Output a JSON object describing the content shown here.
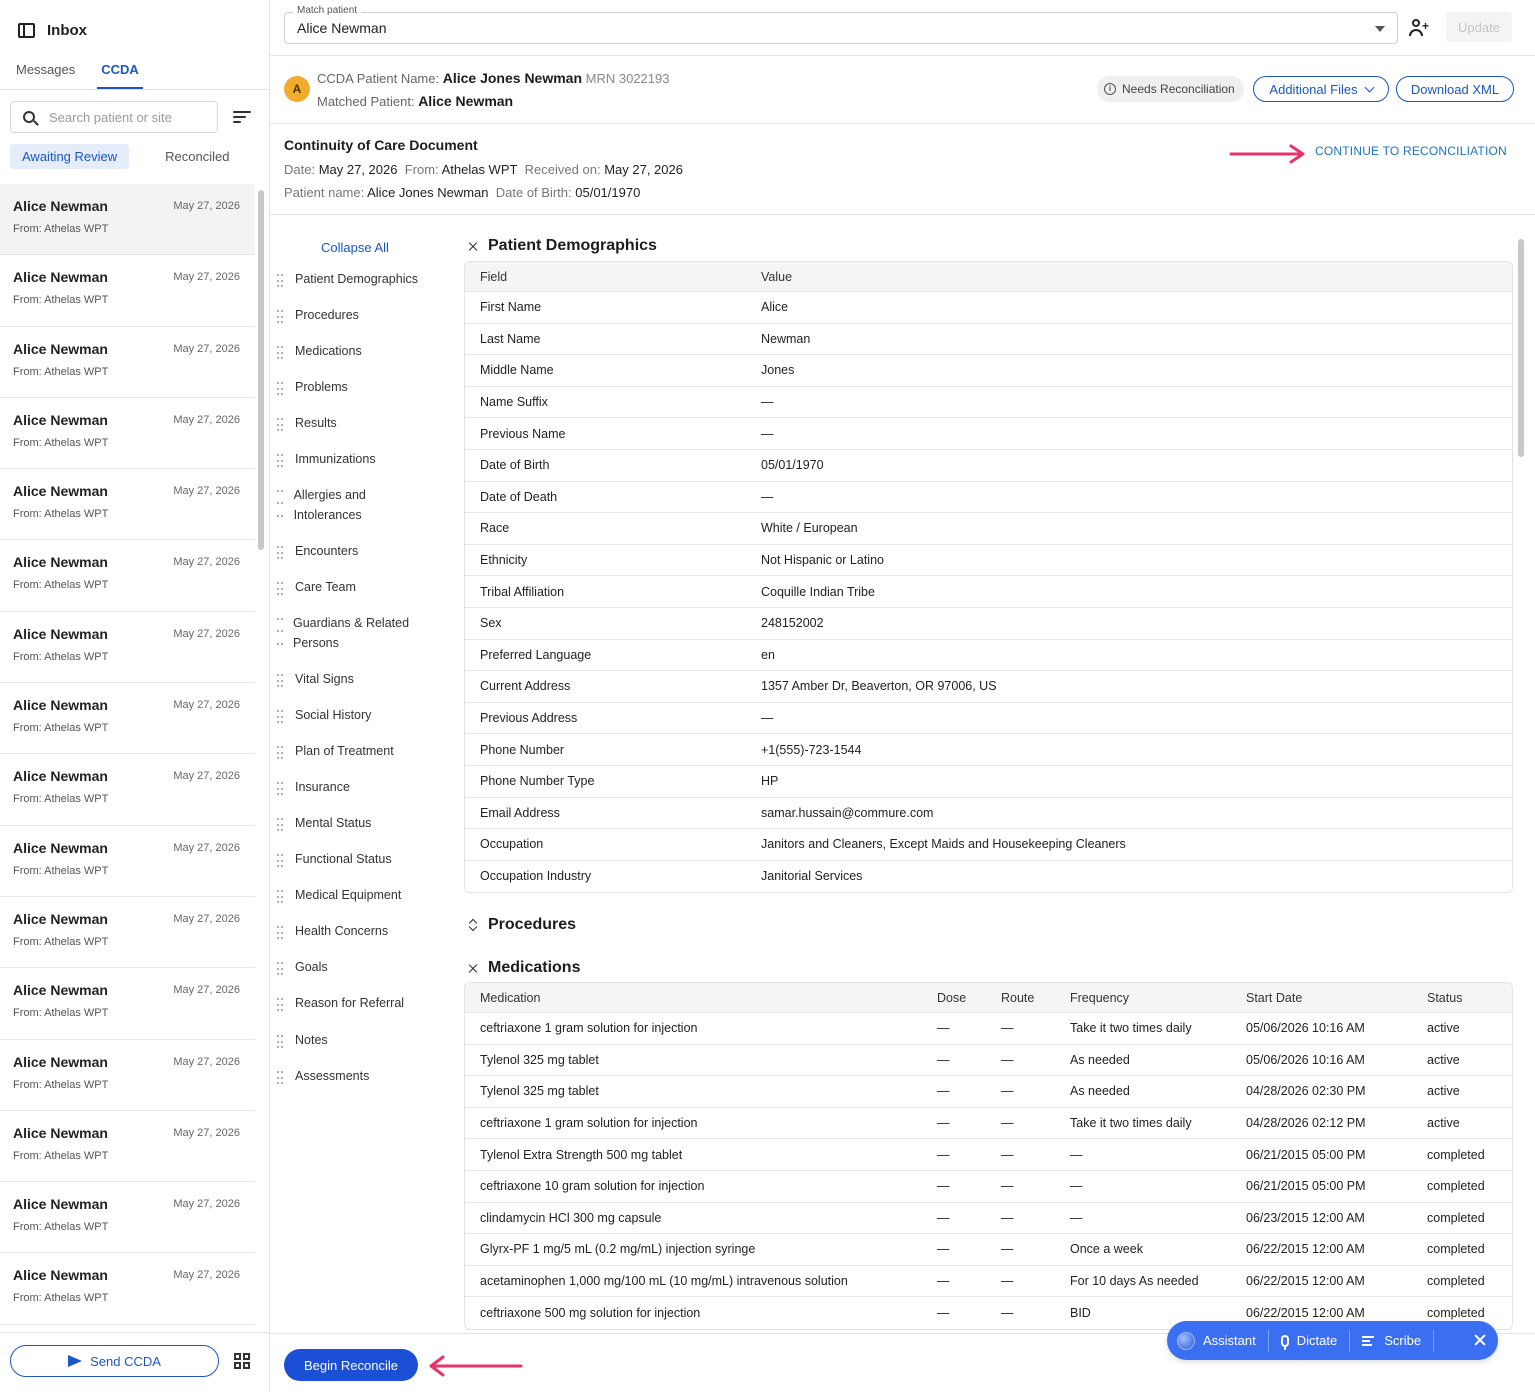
{
  "sidebar": {
    "title": "Inbox",
    "tabs": [
      "Messages",
      "CCDA"
    ],
    "active_tab": "CCDA",
    "search_placeholder": "Search patient or site",
    "filters": [
      "Awaiting Review",
      "Reconciled"
    ],
    "items": [
      {
        "name": "Alice Newman",
        "date": "May 27, 2026",
        "from": "From:  Athelas WPT"
      },
      {
        "name": "Alice Newman",
        "date": "May 27, 2026",
        "from": "From:  Athelas WPT"
      },
      {
        "name": "Alice Newman",
        "date": "May 27, 2026",
        "from": "From:  Athelas WPT"
      },
      {
        "name": "Alice Newman",
        "date": "May 27, 2026",
        "from": "From:  Athelas WPT"
      },
      {
        "name": "Alice Newman",
        "date": "May 27, 2026",
        "from": "From:  Athelas WPT"
      },
      {
        "name": "Alice Newman",
        "date": "May 27, 2026",
        "from": "From:  Athelas WPT"
      },
      {
        "name": "Alice Newman",
        "date": "May 27, 2026",
        "from": "From:  Athelas WPT"
      },
      {
        "name": "Alice Newman",
        "date": "May 27, 2026",
        "from": "From:  Athelas WPT"
      },
      {
        "name": "Alice Newman",
        "date": "May 27, 2026",
        "from": "From:  Athelas WPT"
      },
      {
        "name": "Alice Newman",
        "date": "May 27, 2026",
        "from": "From:  Athelas WPT"
      },
      {
        "name": "Alice Newman",
        "date": "May 27, 2026",
        "from": "From:  Athelas WPT"
      },
      {
        "name": "Alice Newman",
        "date": "May 27, 2026",
        "from": "From:  Athelas WPT"
      },
      {
        "name": "Alice Newman",
        "date": "May 27, 2026",
        "from": "From:  Athelas WPT"
      },
      {
        "name": "Alice Newman",
        "date": "May 27, 2026",
        "from": "From:  Athelas WPT"
      },
      {
        "name": "Alice Newman",
        "date": "May 27, 2026",
        "from": "From:  Athelas WPT"
      },
      {
        "name": "Alice Newman",
        "date": "May 27, 2026",
        "from": "From:  Athelas WPT"
      }
    ],
    "send_label": "Send CCDA"
  },
  "topbar": {
    "match_label": "Match patient",
    "match_value": "Alice Newman",
    "update_label": "Update"
  },
  "patient_bar": {
    "avatar_initial": "A",
    "ccda_name_label": "CCDA Patient Name:",
    "ccda_name": "Alice Jones Newman",
    "mrn": "MRN 3022193",
    "matched_label": "Matched Patient:",
    "matched_name": "Alice Newman",
    "badge": "Needs Reconciliation",
    "additional_files": "Additional Files",
    "download_xml": "Download XML"
  },
  "doc": {
    "title": "Continuity of Care Document",
    "date_label": "Date:",
    "date": "May 27, 2026",
    "from_label": "From:",
    "from": "Athelas WPT",
    "received_label": "Received on:",
    "received": "May 27, 2026",
    "patient_label": "Patient name:",
    "patient": "Alice Jones Newman",
    "dob_label": "Date of Birth:",
    "dob": "05/01/1970",
    "continue": "CONTINUE TO RECONCILIATION"
  },
  "toc": {
    "collapse_all": "Collapse All",
    "items": [
      "Patient Demographics",
      "Procedures",
      "Medications",
      "Problems",
      "Results",
      "Immunizations",
      "Allergies and Intolerances",
      "Encounters",
      "Care Team",
      "Guardians & Related Persons",
      "Vital Signs",
      "Social History",
      "Plan of Treatment",
      "Insurance",
      "Mental Status",
      "Functional Status",
      "Medical Equipment",
      "Health Concerns",
      "Goals",
      "Reason for Referral",
      "Notes",
      "Assessments"
    ]
  },
  "demographics": {
    "title": "Patient Demographics",
    "headers": [
      "Field",
      "Value"
    ],
    "rows": [
      [
        "First Name",
        "Alice"
      ],
      [
        "Last Name",
        "Newman"
      ],
      [
        "Middle Name",
        "Jones"
      ],
      [
        "Name Suffix",
        "—"
      ],
      [
        "Previous Name",
        "—"
      ],
      [
        "Date of Birth",
        "05/01/1970"
      ],
      [
        "Date of Death",
        "—"
      ],
      [
        "Race",
        "White / European"
      ],
      [
        "Ethnicity",
        "Not Hispanic or Latino"
      ],
      [
        "Tribal Affiliation",
        "Coquille Indian Tribe"
      ],
      [
        "Sex",
        "248152002"
      ],
      [
        "Preferred Language",
        "en"
      ],
      [
        "Current Address",
        "1357 Amber Dr, Beaverton, OR 97006, US"
      ],
      [
        "Previous Address",
        "—"
      ],
      [
        "Phone Number",
        "+1(555)-723-1544"
      ],
      [
        "Phone Number Type",
        "HP"
      ],
      [
        "Email Address",
        "samar.hussain@commure.com"
      ],
      [
        "Occupation",
        "Janitors and Cleaners, Except Maids and Housekeeping Cleaners"
      ],
      [
        "Occupation Industry",
        "Janitorial Services"
      ]
    ]
  },
  "procedures": {
    "title": "Procedures"
  },
  "medications": {
    "title": "Medications",
    "headers": [
      "Medication",
      "Dose",
      "Route",
      "Frequency",
      "Start Date",
      "Status"
    ],
    "rows": [
      [
        "ceftriaxone 1 gram solution for injection",
        "—",
        "—",
        "Take it two times daily",
        "05/06/2026 10:16 AM",
        "active"
      ],
      [
        "Tylenol 325 mg tablet",
        "—",
        "—",
        "As needed",
        "05/06/2026 10:16 AM",
        "active"
      ],
      [
        "Tylenol 325 mg tablet",
        "—",
        "—",
        "As needed",
        "04/28/2026 02:30 PM",
        "active"
      ],
      [
        "ceftriaxone 1 gram solution for injection",
        "—",
        "—",
        "Take it two times daily",
        "04/28/2026 02:12 PM",
        "active"
      ],
      [
        "Tylenol Extra Strength 500 mg tablet",
        "—",
        "—",
        "—",
        "06/21/2015 05:00 PM",
        "completed"
      ],
      [
        "ceftriaxone 10 gram solution for injection",
        "—",
        "—",
        "—",
        "06/21/2015 05:00 PM",
        "completed"
      ],
      [
        "clindamycin HCl 300 mg capsule",
        "—",
        "—",
        "—",
        "06/23/2015 12:00 AM",
        "completed"
      ],
      [
        "Glyrx-PF 1 mg/5 mL (0.2 mg/mL) injection syringe",
        "—",
        "—",
        "Once a week",
        "06/22/2015 12:00 AM",
        "completed"
      ],
      [
        "acetaminophen 1,000 mg/100 mL (10 mg/mL) intravenous solution",
        "—",
        "—",
        "For 10 days As needed",
        "06/22/2015 12:00 AM",
        "completed"
      ],
      [
        "ceftriaxone 500 mg solution for injection",
        "—",
        "—",
        "BID",
        "06/22/2015 12:00 AM",
        "completed"
      ]
    ]
  },
  "footer": {
    "begin_label": "Begin Reconcile"
  },
  "assistant": {
    "assistant": "Assistant",
    "dictate": "Dictate",
    "scribe": "Scribe"
  },
  "colors": {
    "primary": "#1a56c4",
    "button": "#1a4fd6",
    "assistant": "#3b6ff2",
    "arrow": "#e8336b",
    "avatar": "#f0ad2b"
  }
}
